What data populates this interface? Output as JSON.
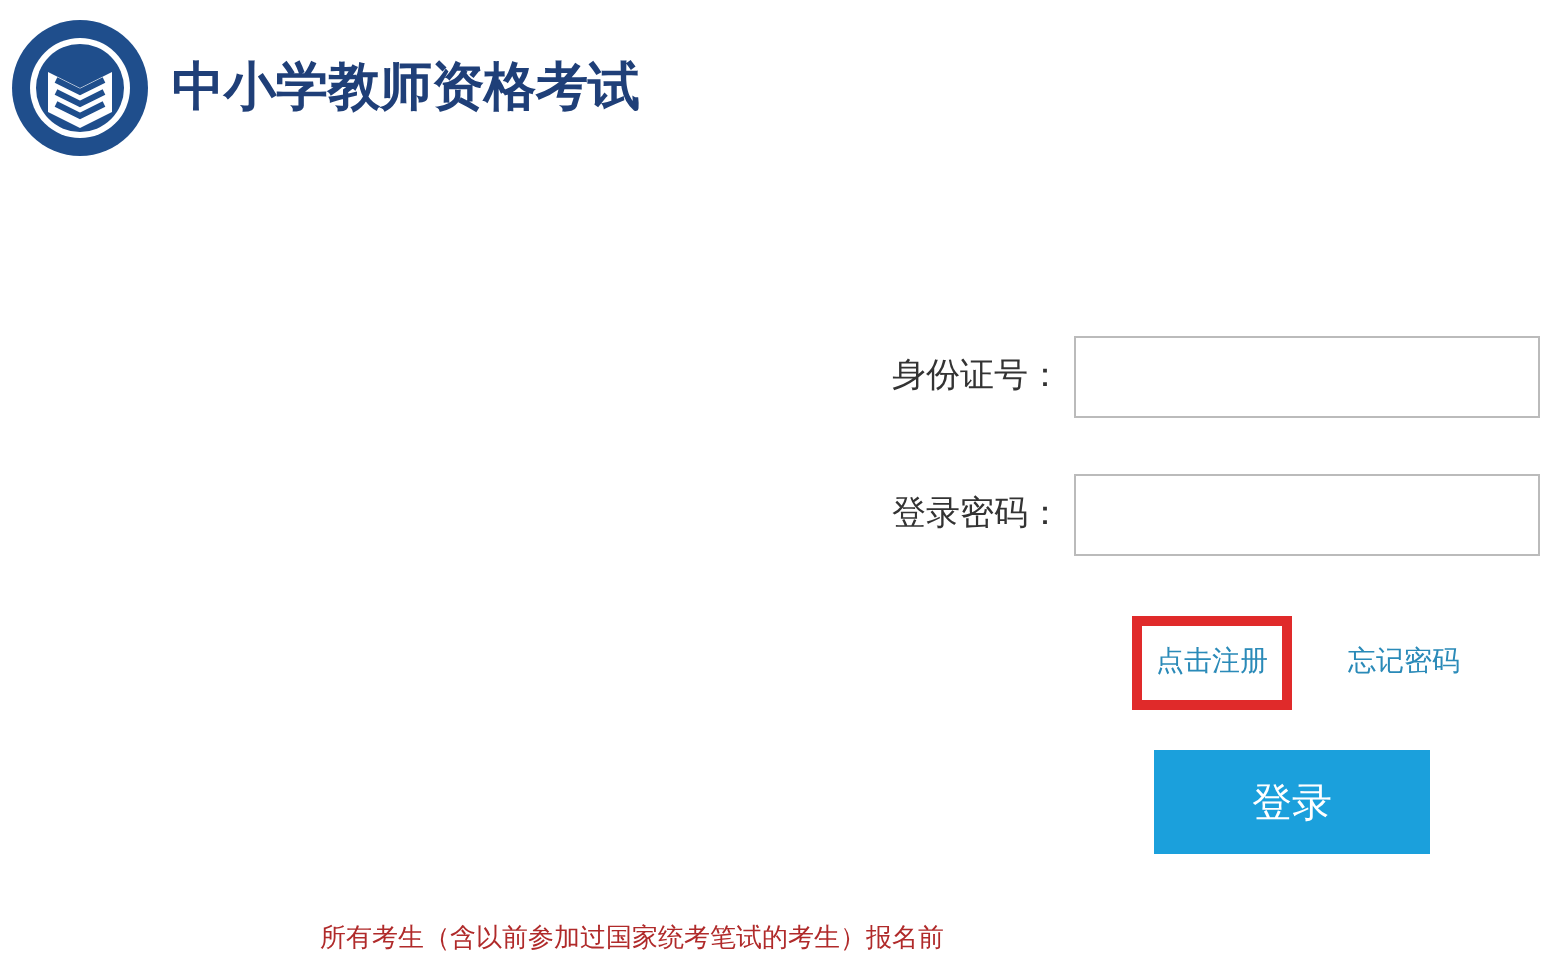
{
  "header": {
    "title": "中小学教师资格考试"
  },
  "form": {
    "fields": [
      {
        "label": "身份证号："
      },
      {
        "label": "登录密码："
      }
    ],
    "links": [
      {
        "label": "点击注册",
        "highlighted": true
      },
      {
        "label": "忘记密码",
        "highlighted": false
      }
    ],
    "submit": "登录"
  },
  "notice": "所有考生（含以前参加过国家统考笔试的考生）报名前"
}
